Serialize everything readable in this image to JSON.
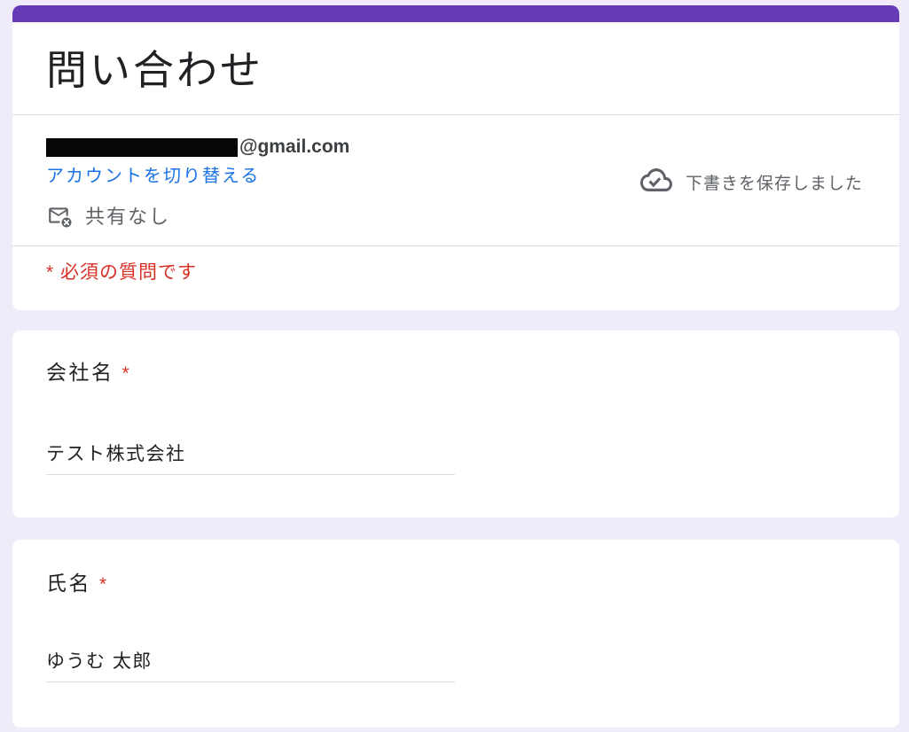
{
  "form": {
    "title": "問い合わせ",
    "account": {
      "email_domain": "@gmail.com",
      "email_redacted": true,
      "switch_account": "アカウントを切り替える",
      "share_status": "共有なし"
    },
    "draft_status": "下書きを保存しました",
    "required_note": "* 必須の質問です",
    "questions": [
      {
        "label": "会社名",
        "required_mark": "*",
        "answer": "テスト株式会社"
      },
      {
        "label": "氏名",
        "required_mark": "*",
        "answer": "ゆうむ 太郎"
      }
    ]
  },
  "icons": {
    "draft": "cloud-done-icon",
    "share": "mail-off-icon"
  },
  "colors": {
    "accent_purple": "#673ab7",
    "page_background": "#f0ebf8",
    "link_blue": "#1a73e8",
    "required_red": "#d93025",
    "text_primary": "#202124",
    "text_secondary": "#5f6368",
    "email_text": "#3c4043",
    "divider": "#dadce0"
  }
}
